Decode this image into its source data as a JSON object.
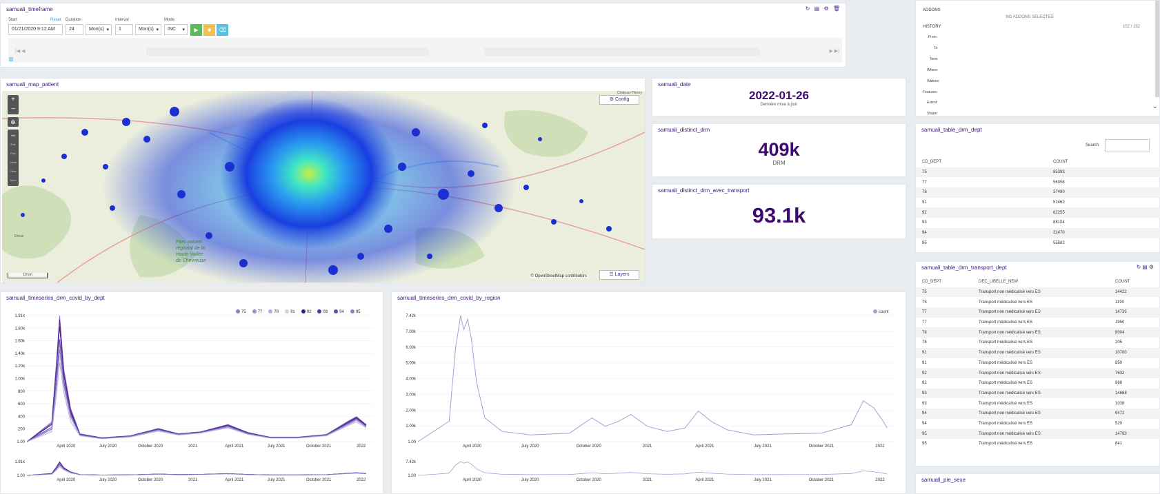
{
  "timeframe": {
    "title": "samuali_timeframe",
    "start_label": "Start",
    "reset_label": "Reset",
    "duration_label": "Duration",
    "interval_label": "Interval",
    "mode_label": "Mode",
    "start_value": "01/21/2020 9:12 AM",
    "duration_value": "24",
    "duration_unit": "Mon(s)",
    "interval_value": "1",
    "interval_unit": "Mon(s)",
    "mode_value": "INC",
    "tools": "↻ ▤ ⚙ 🗑"
  },
  "addons": {
    "title": "ADDONS",
    "empty_text": "NO ADDONS SELECTED",
    "history_label": "HISTORY",
    "history_count": "152 / 152",
    "history_items": [
      "From:",
      "To:",
      "Term:",
      "Where:",
      "Addons:",
      "Features:",
      "Extent:",
      "Shape:"
    ]
  },
  "map": {
    "title": "samuali_map_patient",
    "config_label": "Config",
    "layers_label": "Layers",
    "attribution": "© OpenStreetMap contributors",
    "scale": "10 km",
    "zoom_in": "+",
    "zoom_out": "−",
    "tools": [
      "Info",
      "Edit",
      "Poly",
      "Circle",
      "Clear",
      "Save"
    ],
    "places": [
      "Château-Thierry",
      "Parc naturel régional de la Haute Vallée de Chevreuse",
      "Dreux"
    ]
  },
  "kpi_date": {
    "title": "samuali_date",
    "value": "2022-01-26",
    "caption": "Dernière mise à jour"
  },
  "kpi_drm": {
    "title": "samuali_distinct_drm",
    "value": "409k",
    "caption": "DRM"
  },
  "kpi_transport": {
    "title": "samuali_distinct_drm_avec_transport",
    "value": "93.1k"
  },
  "table_dept": {
    "title": "samuali_table_drm_dept",
    "search_label": "Search:",
    "columns": [
      "CD_DEPT",
      "COUNT"
    ],
    "rows": [
      [
        "75",
        "85393"
      ],
      [
        "77",
        "56358"
      ],
      [
        "78",
        "37490"
      ],
      [
        "91",
        "51462"
      ],
      [
        "92",
        "62255"
      ],
      [
        "93",
        "88104"
      ],
      [
        "94",
        "32470"
      ],
      [
        "95",
        "55582"
      ]
    ]
  },
  "table_transport": {
    "title": "samuali_table_drm_transport_dept",
    "columns": [
      "CD_DEPT",
      "DEC_LIBELLE_NEW",
      "COUNT"
    ],
    "rows": [
      [
        "75",
        "Transport non médicalisé vers ES",
        "14422"
      ],
      [
        "75",
        "Transport médicalisé vers ES",
        "1190"
      ],
      [
        "77",
        "Transport non médicalisé vers ES",
        "14735"
      ],
      [
        "77",
        "Transport médicalisé vers ES",
        "1950"
      ],
      [
        "78",
        "Transport non médicalisé vers ES",
        "8004"
      ],
      [
        "78",
        "Transport médicalisé vers ES",
        "205"
      ],
      [
        "91",
        "Transport non médicalisé vers ES",
        "10700"
      ],
      [
        "91",
        "Transport médicalisé vers ES",
        "650"
      ],
      [
        "92",
        "Transport non médicalisé vers ES",
        "7632"
      ],
      [
        "92",
        "Transport médicalisé vers ES",
        "868"
      ],
      [
        "93",
        "Transport non médicalisé vers ES",
        "14668"
      ],
      [
        "93",
        "Transport médicalisé vers ES",
        "1038"
      ],
      [
        "94",
        "Transport non médicalisé vers ES",
        "6472"
      ],
      [
        "94",
        "Transport médicalisé vers ES",
        "520"
      ],
      [
        "95",
        "Transport non médicalisé vers ES",
        "14793"
      ],
      [
        "95",
        "Transport médicalisé vers ES",
        "841"
      ]
    ]
  },
  "pie": {
    "title": "samuali_pie_sexe"
  },
  "ts_dept": {
    "title": "samuali_timeseries_drm_covid_by_dept",
    "legend": [
      "75",
      "77",
      "78",
      "91",
      "92",
      "93",
      "94",
      "95"
    ],
    "legend_colors": [
      "#8c7fc4",
      "#9b90cc",
      "#b7aedb",
      "#d6d1ea",
      "#3f1a87",
      "#5b2fa0",
      "#6a4bb0",
      "#8f86c6"
    ],
    "yticks": [
      "1.91k",
      "1.80k",
      "1.60k",
      "1.40k",
      "1.20k",
      "1.00k",
      "800",
      "600",
      "400",
      "200",
      "1.00"
    ],
    "mini_yticks": [
      "1.91k",
      "1.00"
    ]
  },
  "ts_region": {
    "title": "samuali_timeseries_drm_covid_by_region",
    "legend": [
      "count"
    ],
    "legend_colors": [
      "#a79fd6"
    ],
    "yticks": [
      "7.42k",
      "7.00k",
      "6.00k",
      "5.00k",
      "4.00k",
      "3.00k",
      "2.00k",
      "1.00k",
      "1.00"
    ],
    "mini_yticks": [
      "7.42k",
      "1.00"
    ]
  },
  "xticks": [
    "April 2020",
    "July 2020",
    "October 2020",
    "2021",
    "April 2021",
    "July 2021",
    "October 2021",
    "2022"
  ],
  "chart_data": [
    {
      "type": "line",
      "x": [
        "2020-01-21",
        "2020-03-15",
        "2020-03-25",
        "2020-04-01",
        "2020-04-10",
        "2020-04-25",
        "2020-05-15",
        "2020-07-01",
        "2020-09-01",
        "2020-11-01",
        "2020-12-15",
        "2021-02-01",
        "2021-04-01",
        "2021-05-15",
        "2021-07-01",
        "2021-09-01",
        "2021-11-01",
        "2021-12-20",
        "2022-01-05",
        "2022-01-26"
      ],
      "series": [
        {
          "name": "75",
          "values": [
            1,
            300,
            1200,
            1910,
            1100,
            500,
            120,
            60,
            90,
            200,
            120,
            150,
            260,
            140,
            70,
            70,
            110,
            320,
            380,
            260
          ]
        },
        {
          "name": "77",
          "values": [
            1,
            200,
            900,
            1500,
            900,
            400,
            100,
            50,
            80,
            180,
            110,
            140,
            230,
            120,
            60,
            60,
            100,
            280,
            340,
            230
          ]
        },
        {
          "name": "78",
          "values": [
            1,
            150,
            700,
            1200,
            750,
            300,
            90,
            45,
            70,
            160,
            100,
            130,
            210,
            110,
            55,
            55,
            90,
            250,
            300,
            210
          ]
        },
        {
          "name": "91",
          "values": [
            1,
            170,
            800,
            1300,
            800,
            350,
            95,
            50,
            75,
            170,
            105,
            135,
            220,
            115,
            58,
            58,
            95,
            260,
            320,
            220
          ]
        },
        {
          "name": "92",
          "values": [
            1,
            260,
            1100,
            1750,
            1000,
            450,
            110,
            55,
            85,
            190,
            115,
            145,
            250,
            130,
            65,
            65,
            105,
            300,
            360,
            250
          ]
        },
        {
          "name": "93",
          "values": [
            1,
            280,
            1150,
            1850,
            1050,
            480,
            115,
            58,
            88,
            195,
            118,
            148,
            255,
            135,
            68,
            68,
            108,
            310,
            370,
            255
          ]
        },
        {
          "name": "94",
          "values": [
            1,
            220,
            950,
            1550,
            920,
            420,
            105,
            52,
            82,
            185,
            112,
            142,
            240,
            125,
            62,
            62,
            102,
            290,
            350,
            240
          ]
        },
        {
          "name": "95",
          "values": [
            1,
            190,
            850,
            1400,
            850,
            380,
            100,
            50,
            78,
            175,
            108,
            138,
            225,
            118,
            60,
            60,
            98,
            270,
            330,
            225
          ]
        }
      ],
      "ylim": [
        1,
        1910
      ]
    },
    {
      "type": "line",
      "x": [
        "2020-01-21",
        "2020-03-10",
        "2020-03-20",
        "2020-03-28",
        "2020-04-02",
        "2020-04-08",
        "2020-04-14",
        "2020-04-22",
        "2020-05-05",
        "2020-06-01",
        "2020-07-15",
        "2020-09-15",
        "2020-10-20",
        "2020-11-10",
        "2020-12-01",
        "2020-12-20",
        "2021-01-15",
        "2021-02-15",
        "2021-03-15",
        "2021-04-05",
        "2021-04-25",
        "2021-05-20",
        "2021-07-01",
        "2021-08-15",
        "2021-10-15",
        "2021-12-01",
        "2021-12-20",
        "2022-01-05",
        "2022-01-20",
        "2022-01-26"
      ],
      "series": [
        {
          "name": "count",
          "values": [
            1,
            1200,
            5500,
            7420,
            6600,
            7200,
            6000,
            3500,
            1400,
            600,
            400,
            500,
            1400,
            900,
            1200,
            1600,
            900,
            600,
            800,
            1800,
            1200,
            700,
            400,
            450,
            500,
            1000,
            2400,
            2000,
            1200,
            800
          ]
        }
      ],
      "ylim": [
        1,
        7420
      ]
    }
  ]
}
